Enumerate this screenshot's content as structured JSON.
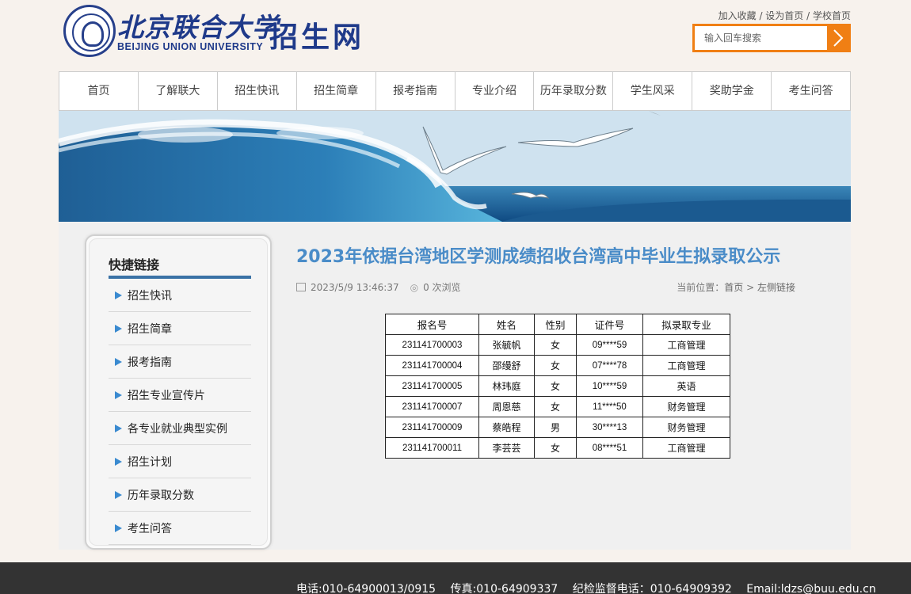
{
  "header": {
    "university_cn": "北京联合大学",
    "university_en": "BEIJING UNION UNIVERSITY",
    "site_name": "招生网",
    "links": [
      "加入收藏",
      "设为首页",
      "学校首页"
    ],
    "search_placeholder": "输入回车搜索"
  },
  "nav": [
    "首页",
    "了解联大",
    "招生快讯",
    "招生简章",
    "报考指南",
    "专业介绍",
    "历年录取分数",
    "学生风采",
    "奖助学金",
    "考生问答"
  ],
  "sidebar": {
    "title": "快捷链接",
    "items": [
      "招生快讯",
      "招生简章",
      "报考指南",
      "招生专业宣传片",
      "各专业就业典型实例",
      "招生计划",
      "历年录取分数",
      "考生问答"
    ]
  },
  "article": {
    "title": "2023年依据台湾地区学测成绩招收台湾高中毕业生拟录取公示",
    "date": "2023/5/9 13:46:37",
    "views": "0 次浏览",
    "location_label": "当前位置：",
    "location_home": "首页",
    "location_sep": ">",
    "location_current": "左侧链接"
  },
  "table": {
    "headers": [
      "报名号",
      "姓名",
      "性别",
      "证件号",
      "拟录取专业"
    ],
    "rows": [
      [
        "231141700003",
        "张毓帆",
        "女",
        "09****59",
        "工商管理"
      ],
      [
        "231141700004",
        "邵缦舒",
        "女",
        "07****78",
        "工商管理"
      ],
      [
        "231141700005",
        "林玮庭",
        "女",
        "10****59",
        "英语"
      ],
      [
        "231141700007",
        "周恩慈",
        "女",
        "11****50",
        "财务管理"
      ],
      [
        "231141700009",
        "蔡皓程",
        "男",
        "30****13",
        "财务管理"
      ],
      [
        "231141700011",
        "李芸芸",
        "女",
        "08****51",
        "工商管理"
      ]
    ]
  },
  "footer": {
    "phone": "电话:010-64900013/0915",
    "fax": "传真:010-64909337",
    "supervision": "纪检监督电话：010-64909392",
    "email": "Email:ldzs@buu.edu.cn"
  },
  "colors": {
    "accent_orange": "#f07f14",
    "title_blue": "#4a8cc8",
    "brand_navy": "#1f3a8a",
    "footer_bg": "#333333"
  }
}
